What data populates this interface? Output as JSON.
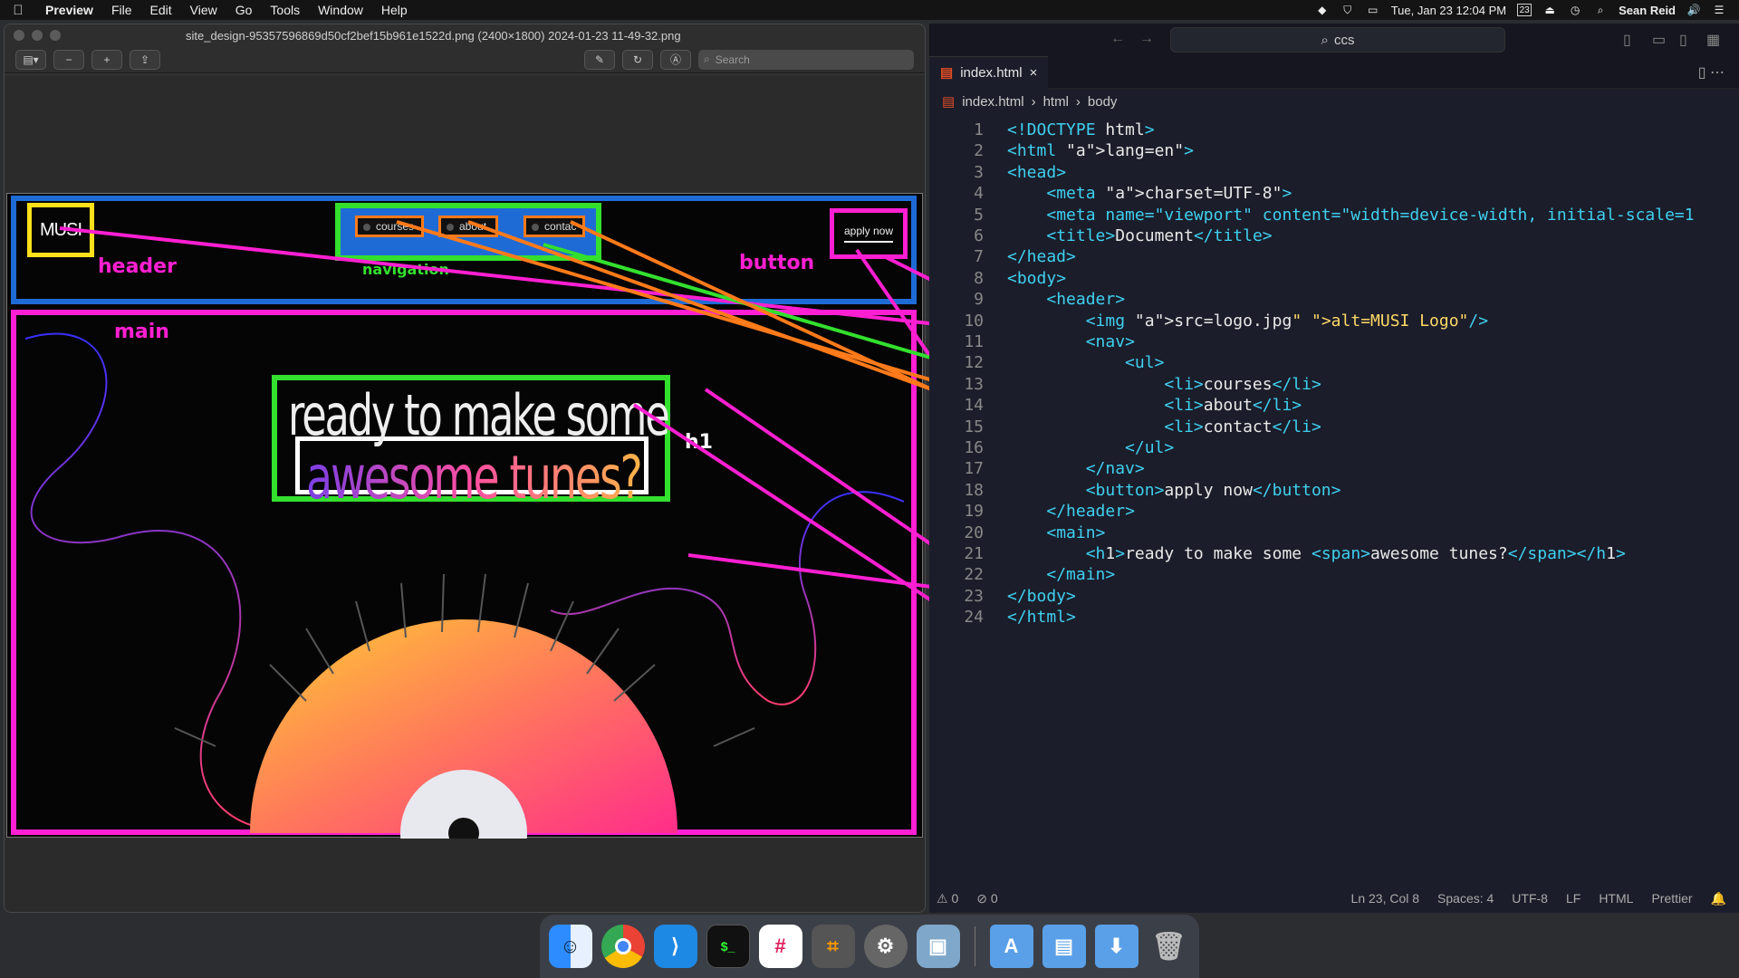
{
  "menubar": {
    "app": "Preview",
    "items": [
      "File",
      "Edit",
      "View",
      "Go",
      "Tools",
      "Window",
      "Help"
    ],
    "datetime": "Tue, Jan 23 12:04 PM",
    "calendar_day": "23",
    "user": "Sean Reid"
  },
  "preview": {
    "title": "site_design-95357596869d50cf2bef15b961e1522d.png (2400×1800) 2024-01-23 11-49-32.png",
    "search_placeholder": "Search"
  },
  "design": {
    "logo": "MUSI",
    "nav": [
      "courses",
      "about",
      "contac"
    ],
    "apply_button": "apply now",
    "hero_line1": "ready to make some",
    "hero_line2": "awesome tunes?",
    "labels": {
      "header": "header",
      "navigation": "navigation",
      "button": "button",
      "main": "main",
      "h1": "h1"
    },
    "colors": {
      "header_box": "#1f6bd6",
      "logo_box": "#ffe01a",
      "nav_box": "#33e02e",
      "nav_item_box": "#ff7a1a",
      "pink": "#ff1fd2"
    }
  },
  "editor": {
    "search": "ccs",
    "tab": "index.html",
    "breadcrumb": [
      "index.html",
      "html",
      "body"
    ],
    "lines": [
      "<!DOCTYPE html>",
      "<html lang=\"en\">",
      "<head>",
      "    <meta charset=\"UTF-8\">",
      "    <meta name=\"viewport\" content=\"width=device-width, initial-scale=1",
      "    <title>Document</title>",
      "</head>",
      "<body>",
      "    <header>",
      "        <img src=\"logo.jpg\" alt=\"MUSI Logo\"/>",
      "        <nav>",
      "            <ul>",
      "                <li>courses</li>",
      "                <li>about</li>",
      "                <li>contact</li>",
      "            </ul>",
      "        </nav>",
      "        <button>apply now</button>",
      "    </header>",
      "    <main>",
      "        <h1>ready to make some <span>awesome tunes?</span></h1>",
      "    </main>",
      "</body>",
      "</html>"
    ],
    "status": {
      "errors": "0",
      "warnings": "0",
      "position": "Ln 23, Col 8",
      "spaces": "Spaces: 4",
      "encoding": "UTF-8",
      "eol": "LF",
      "language": "HTML",
      "formatter": "Prettier"
    }
  },
  "dock": [
    "Finder",
    "Chrome",
    "VS Code",
    "Terminal",
    "Slack",
    "Calculator",
    "System Settings",
    "Preview"
  ]
}
